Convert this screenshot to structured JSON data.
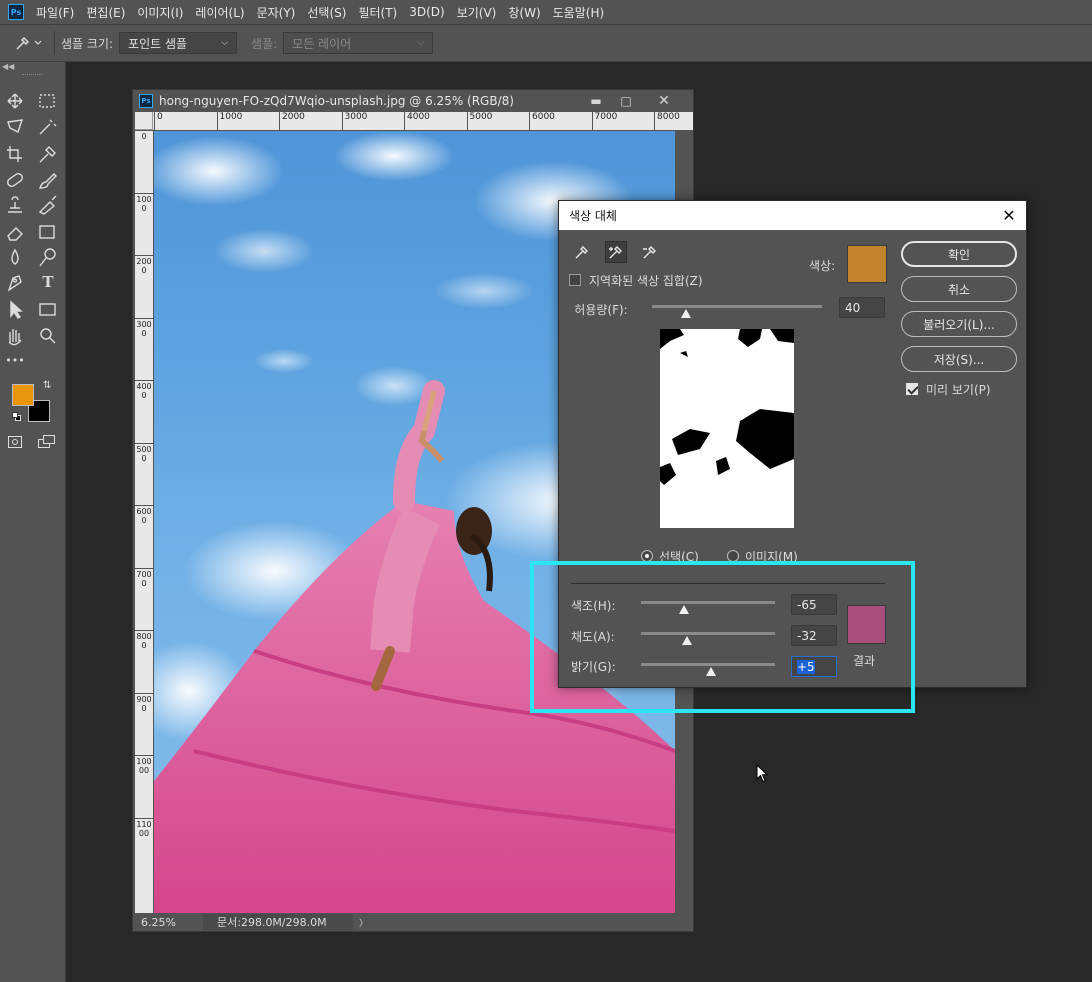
{
  "menu": [
    "파일(F)",
    "편집(E)",
    "이미지(I)",
    "레이어(L)",
    "문자(Y)",
    "선택(S)",
    "필터(T)",
    "3D(D)",
    "보기(V)",
    "창(W)",
    "도움말(H)"
  ],
  "app": {
    "logo": "Ps"
  },
  "options": {
    "sample_size_label": "샘플 크기:",
    "sample_size_value": "포인트 샘플",
    "sample_label": "샘플:",
    "sample_value": "모든 레이어"
  },
  "toolbar": {
    "tools": [
      "move-icon",
      "marquee-icon",
      "lasso-icon",
      "magic-wand-icon",
      "crop-icon",
      "eyedropper-icon",
      "healing-brush-icon",
      "brush-icon",
      "clone-stamp-icon",
      "history-brush-icon",
      "eraser-icon",
      "gradient-icon",
      "blur-icon",
      "dodge-icon",
      "pen-icon",
      "type-icon",
      "path-selection-icon",
      "rectangle-icon",
      "hand-icon",
      "zoom-icon",
      "more-tools-icon"
    ],
    "type_glyph": "T",
    "more_glyph": "•••",
    "foreground_color": "#e8960c",
    "background_color": "#000000"
  },
  "document": {
    "title": "hong-nguyen-FO-zQd7Wqio-unsplash.jpg @ 6.25% (RGB/8)",
    "ruler_h": [
      "0",
      "1000",
      "2000",
      "3000",
      "4000",
      "5000",
      "6000",
      "7000",
      "8000"
    ],
    "ruler_v": [
      "0",
      "1000",
      "2000",
      "3000",
      "4000",
      "5000",
      "6000",
      "7000",
      "8000",
      "9000",
      "10000",
      "11000"
    ],
    "zoom": "6.25%",
    "doc_size": "문서:298.0M/298.0M",
    "status_arrow": "〉"
  },
  "dialog": {
    "title": "색상 대체",
    "localized_clusters_label": "지역화된 색상 집합(Z)",
    "localized_clusters_checked": false,
    "color_label": "색상:",
    "color_swatch": "#c2842e",
    "fuzziness_label": "허용량(F):",
    "fuzziness_value": "40",
    "fuzziness_fraction": 0.2,
    "radio_selection": "선택(C)",
    "radio_image": "이미지(M)",
    "selected_mode": "selection",
    "hue_label": "색조(H):",
    "hue_value": "-65",
    "hue_fraction": 0.32,
    "saturation_label": "채도(A):",
    "saturation_value": "-32",
    "saturation_fraction": 0.34,
    "lightness_label": "밝기(G):",
    "lightness_value": "+5",
    "lightness_fraction": 0.52,
    "result_label": "결과",
    "result_swatch": "#a84e7c",
    "buttons": {
      "ok": "확인",
      "cancel": "취소",
      "load": "불러오기(L)...",
      "save": "저장(S)..."
    },
    "preview_label": "미리 보기(P)",
    "preview_checked": true
  },
  "highlight_color": "#29e6f2"
}
